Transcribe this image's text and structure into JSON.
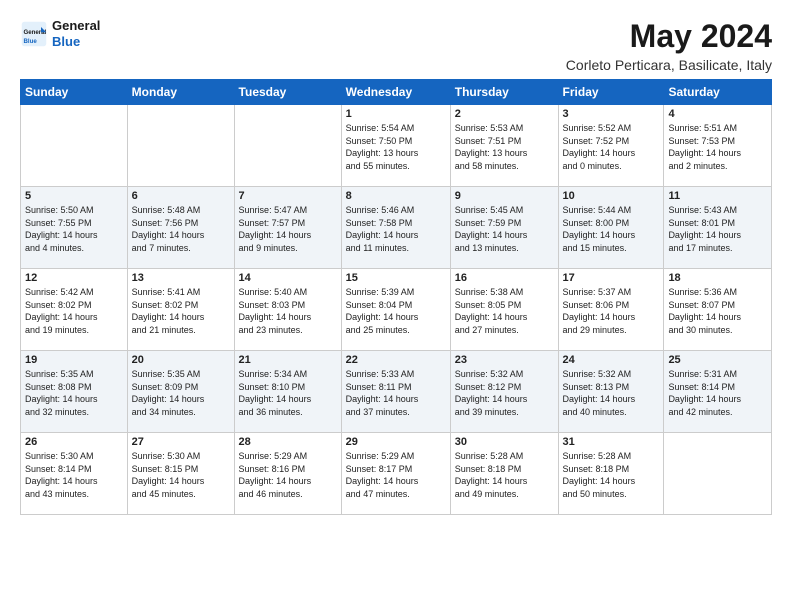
{
  "logo": {
    "line1": "General",
    "line2": "Blue"
  },
  "title": "May 2024",
  "subtitle": "Corleto Perticara, Basilicate, Italy",
  "days_of_week": [
    "Sunday",
    "Monday",
    "Tuesday",
    "Wednesday",
    "Thursday",
    "Friday",
    "Saturday"
  ],
  "weeks": [
    [
      {
        "day": "",
        "info": ""
      },
      {
        "day": "",
        "info": ""
      },
      {
        "day": "",
        "info": ""
      },
      {
        "day": "1",
        "info": "Sunrise: 5:54 AM\nSunset: 7:50 PM\nDaylight: 13 hours\nand 55 minutes."
      },
      {
        "day": "2",
        "info": "Sunrise: 5:53 AM\nSunset: 7:51 PM\nDaylight: 13 hours\nand 58 minutes."
      },
      {
        "day": "3",
        "info": "Sunrise: 5:52 AM\nSunset: 7:52 PM\nDaylight: 14 hours\nand 0 minutes."
      },
      {
        "day": "4",
        "info": "Sunrise: 5:51 AM\nSunset: 7:53 PM\nDaylight: 14 hours\nand 2 minutes."
      }
    ],
    [
      {
        "day": "5",
        "info": "Sunrise: 5:50 AM\nSunset: 7:55 PM\nDaylight: 14 hours\nand 4 minutes."
      },
      {
        "day": "6",
        "info": "Sunrise: 5:48 AM\nSunset: 7:56 PM\nDaylight: 14 hours\nand 7 minutes."
      },
      {
        "day": "7",
        "info": "Sunrise: 5:47 AM\nSunset: 7:57 PM\nDaylight: 14 hours\nand 9 minutes."
      },
      {
        "day": "8",
        "info": "Sunrise: 5:46 AM\nSunset: 7:58 PM\nDaylight: 14 hours\nand 11 minutes."
      },
      {
        "day": "9",
        "info": "Sunrise: 5:45 AM\nSunset: 7:59 PM\nDaylight: 14 hours\nand 13 minutes."
      },
      {
        "day": "10",
        "info": "Sunrise: 5:44 AM\nSunset: 8:00 PM\nDaylight: 14 hours\nand 15 minutes."
      },
      {
        "day": "11",
        "info": "Sunrise: 5:43 AM\nSunset: 8:01 PM\nDaylight: 14 hours\nand 17 minutes."
      }
    ],
    [
      {
        "day": "12",
        "info": "Sunrise: 5:42 AM\nSunset: 8:02 PM\nDaylight: 14 hours\nand 19 minutes."
      },
      {
        "day": "13",
        "info": "Sunrise: 5:41 AM\nSunset: 8:02 PM\nDaylight: 14 hours\nand 21 minutes."
      },
      {
        "day": "14",
        "info": "Sunrise: 5:40 AM\nSunset: 8:03 PM\nDaylight: 14 hours\nand 23 minutes."
      },
      {
        "day": "15",
        "info": "Sunrise: 5:39 AM\nSunset: 8:04 PM\nDaylight: 14 hours\nand 25 minutes."
      },
      {
        "day": "16",
        "info": "Sunrise: 5:38 AM\nSunset: 8:05 PM\nDaylight: 14 hours\nand 27 minutes."
      },
      {
        "day": "17",
        "info": "Sunrise: 5:37 AM\nSunset: 8:06 PM\nDaylight: 14 hours\nand 29 minutes."
      },
      {
        "day": "18",
        "info": "Sunrise: 5:36 AM\nSunset: 8:07 PM\nDaylight: 14 hours\nand 30 minutes."
      }
    ],
    [
      {
        "day": "19",
        "info": "Sunrise: 5:35 AM\nSunset: 8:08 PM\nDaylight: 14 hours\nand 32 minutes."
      },
      {
        "day": "20",
        "info": "Sunrise: 5:35 AM\nSunset: 8:09 PM\nDaylight: 14 hours\nand 34 minutes."
      },
      {
        "day": "21",
        "info": "Sunrise: 5:34 AM\nSunset: 8:10 PM\nDaylight: 14 hours\nand 36 minutes."
      },
      {
        "day": "22",
        "info": "Sunrise: 5:33 AM\nSunset: 8:11 PM\nDaylight: 14 hours\nand 37 minutes."
      },
      {
        "day": "23",
        "info": "Sunrise: 5:32 AM\nSunset: 8:12 PM\nDaylight: 14 hours\nand 39 minutes."
      },
      {
        "day": "24",
        "info": "Sunrise: 5:32 AM\nSunset: 8:13 PM\nDaylight: 14 hours\nand 40 minutes."
      },
      {
        "day": "25",
        "info": "Sunrise: 5:31 AM\nSunset: 8:14 PM\nDaylight: 14 hours\nand 42 minutes."
      }
    ],
    [
      {
        "day": "26",
        "info": "Sunrise: 5:30 AM\nSunset: 8:14 PM\nDaylight: 14 hours\nand 43 minutes."
      },
      {
        "day": "27",
        "info": "Sunrise: 5:30 AM\nSunset: 8:15 PM\nDaylight: 14 hours\nand 45 minutes."
      },
      {
        "day": "28",
        "info": "Sunrise: 5:29 AM\nSunset: 8:16 PM\nDaylight: 14 hours\nand 46 minutes."
      },
      {
        "day": "29",
        "info": "Sunrise: 5:29 AM\nSunset: 8:17 PM\nDaylight: 14 hours\nand 47 minutes."
      },
      {
        "day": "30",
        "info": "Sunrise: 5:28 AM\nSunset: 8:18 PM\nDaylight: 14 hours\nand 49 minutes."
      },
      {
        "day": "31",
        "info": "Sunrise: 5:28 AM\nSunset: 8:18 PM\nDaylight: 14 hours\nand 50 minutes."
      },
      {
        "day": "",
        "info": ""
      }
    ]
  ],
  "colors": {
    "header_bg": "#1565c0",
    "header_text": "#ffffff",
    "row_odd_bg": "#f0f4f8",
    "row_even_bg": "#ffffff"
  }
}
